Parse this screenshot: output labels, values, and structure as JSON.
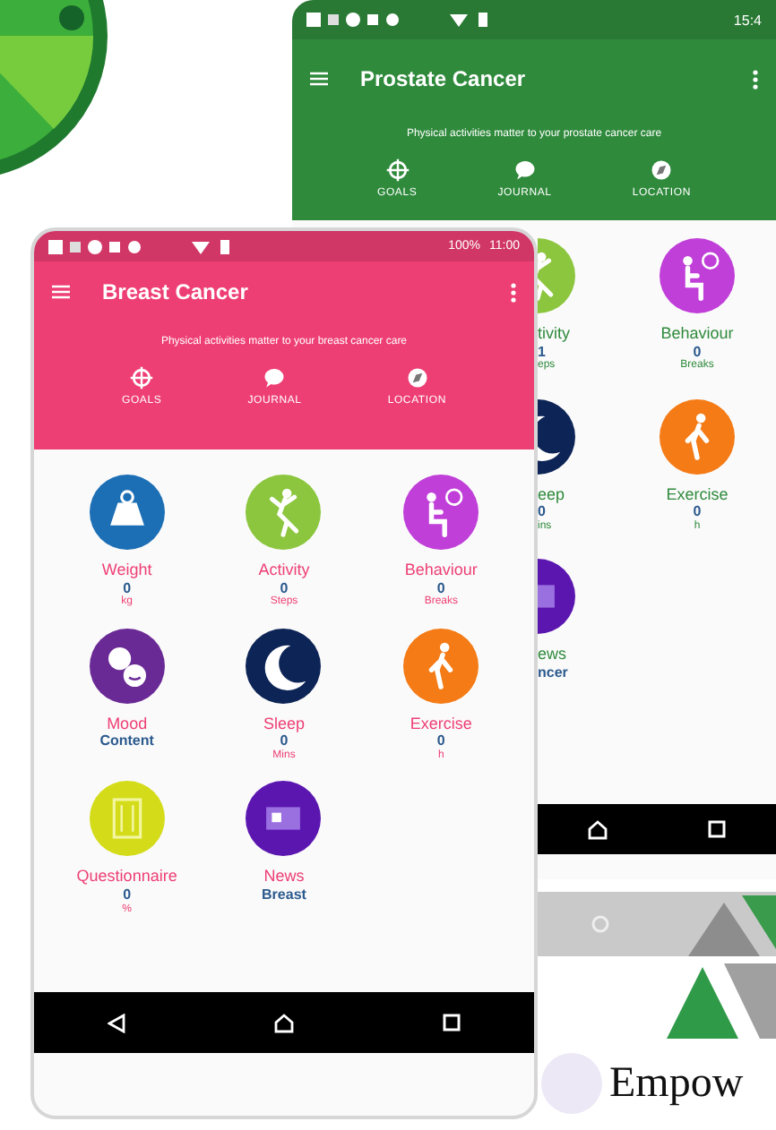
{
  "screens": [
    {
      "color": "#2f8a3c",
      "status": {
        "time": "15:4"
      },
      "title": "Prostate Cancer",
      "subtitle": "Physical activities matter to your prostate cancer care",
      "actions": [
        {
          "kind": "goals",
          "label": "GOALS"
        },
        {
          "kind": "journal",
          "label": "JOURNAL"
        },
        {
          "kind": "location",
          "label": "LOCATION"
        }
      ],
      "tiles": [
        {
          "kind": "activity",
          "color": "#8cc63f",
          "partial": true,
          "label": "tivity",
          "value": "1",
          "unit": "eps"
        },
        {
          "kind": "behaviour",
          "color": "#c03fd8",
          "partial": false,
          "label": "Behaviour",
          "value": "0",
          "unit": "Breaks"
        },
        {
          "kind": "sleep",
          "color": "#0d2456",
          "partial": true,
          "label": "eep",
          "value": "0",
          "unit": "ins"
        },
        {
          "kind": "exercise",
          "color": "#f47b16",
          "partial": false,
          "label": "Exercise",
          "value": "0",
          "unit": "h"
        },
        {
          "kind": "news",
          "color": "#5b16b0",
          "partial": true,
          "label": "ews",
          "value": "ncer"
        }
      ]
    },
    {
      "color": "#ee3f75",
      "status": {
        "battery": "100%",
        "time": "11:00"
      },
      "title": "Breast Cancer",
      "subtitle": "Physical activities matter to your breast cancer care",
      "actions": [
        {
          "kind": "goals",
          "label": "GOALS"
        },
        {
          "kind": "journal",
          "label": "JOURNAL"
        },
        {
          "kind": "location",
          "label": "LOCATION"
        }
      ],
      "tiles": [
        {
          "kind": "weight",
          "color": "#1c6fb5",
          "partial": false,
          "label": "Weight",
          "value": "0",
          "unit": "kg"
        },
        {
          "kind": "activity",
          "color": "#8cc63f",
          "partial": false,
          "label": "Activity",
          "value": "0",
          "unit": "Steps"
        },
        {
          "kind": "behaviour",
          "color": "#c03fd8",
          "partial": false,
          "label": "Behaviour",
          "value": "0",
          "unit": "Breaks"
        },
        {
          "kind": "mood",
          "color": "#6a2a96",
          "partial": false,
          "label": "Mood",
          "value": "Content"
        },
        {
          "kind": "sleep",
          "color": "#0d2456",
          "partial": false,
          "label": "Sleep",
          "value": "0",
          "unit": "Mins"
        },
        {
          "kind": "exercise",
          "color": "#f47b16",
          "partial": false,
          "label": "Exercise",
          "value": "0",
          "unit": "h"
        },
        {
          "kind": "questionnaire",
          "color": "#d4dc1a",
          "partial": false,
          "label": "Questionnaire",
          "value": "0",
          "unit": "%"
        },
        {
          "kind": "news",
          "color": "#5b16b0",
          "partial": false,
          "label": "News",
          "value": "Breast"
        }
      ]
    }
  ],
  "brand": {
    "text": "Empow"
  }
}
